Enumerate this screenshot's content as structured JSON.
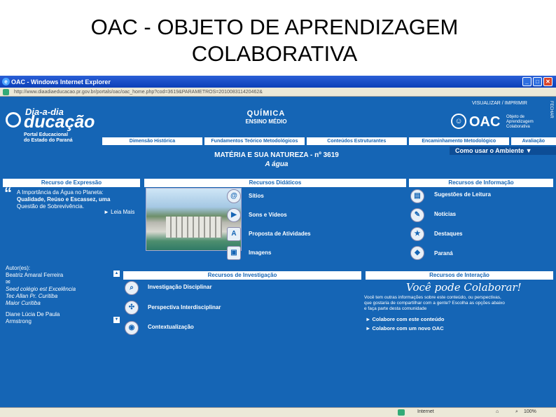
{
  "slide": {
    "title_line1": "OAC - OBJETO DE APRENDIZAGEM",
    "title_line2": "COLABORATIVA"
  },
  "window": {
    "title": "OAC - Windows Internet Explorer",
    "address": "http://www.diaadiaeducacao.pr.gov.br/portals/oac/oac_home.php?cod=3619&PARAMETROS=201008311420462&"
  },
  "header": {
    "logo_line1": "Dia-a-dia",
    "logo_line2": "ducação",
    "portal_line1": "Portal Educacional",
    "portal_line2": "do Estado do Paraná",
    "subject": "QUÍMICA",
    "level": "ENSINO MÉDIO",
    "print_link": "VISUALIZAR / IMPRIMIR",
    "oac_logo": "OAC",
    "oac_sub1": "Objeto de",
    "oac_sub2": "Aprendizagem",
    "oac_sub3": "Colaborativa",
    "close_label": "FECHAR"
  },
  "nav": [
    "Dimensão Histórica",
    "Fundamentos Teórico Metodológicos",
    "Conteúdos Estruturantes",
    "Encaminhamento Metodológico",
    "Avaliação"
  ],
  "como_usar": "Como usar o Ambiente ▼",
  "materia": "MATÉRIA E SUA NATUREZA - nº 3619",
  "tema": "A água",
  "expressao": {
    "header": "Recurso de Expressão",
    "quote_line1": "A Importância da Água no Planeta:",
    "quote_line2": "Qualidade, Reúso e Escassez, uma",
    "quote_line3": "Questão de Sobrevivência.",
    "leia_mais": "► Leia Mais"
  },
  "didaticos": {
    "header": "Recursos Didáticos",
    "items": [
      "Sítios",
      "Sons e Vídeos",
      "Proposta de Atividades",
      "Imagens"
    ]
  },
  "informacao": {
    "header": "Recursos de Informação",
    "items": [
      "Sugestões de Leitura",
      "Notícias",
      "Destaques",
      "Paraná"
    ]
  },
  "autores": {
    "label": "Autor(es):",
    "name1": "Beatriz Amaral Ferreira",
    "line2": "Seed colégio est Excelência",
    "line3": "Tec Allan Pr. Curitiba",
    "line4": "Maior Curitiba",
    "name2": "Diane Lúcia De Paula",
    "name3": "Armstrong"
  },
  "investigacao": {
    "header": "Recursos de Investigação",
    "items": [
      "Investigação Disciplinar",
      "Perspectiva Interdisciplinar",
      "Contextualização"
    ]
  },
  "interacao": {
    "header": "Recursos de Interação",
    "headline": "Você pode Colaborar!",
    "text_line1": "Você tem outras informações sobre este conteúdo, ou perspectivas,",
    "text_line2": "que gostaria de compartilhar com a gente? Escolha as opções abaixo",
    "text_line3": "e faça parte desta comunidade",
    "link1": "Colabore com este conteúdo",
    "link2": "Colabore com um novo OAC"
  },
  "status": {
    "zone": "Internet",
    "zoom": "100%"
  }
}
